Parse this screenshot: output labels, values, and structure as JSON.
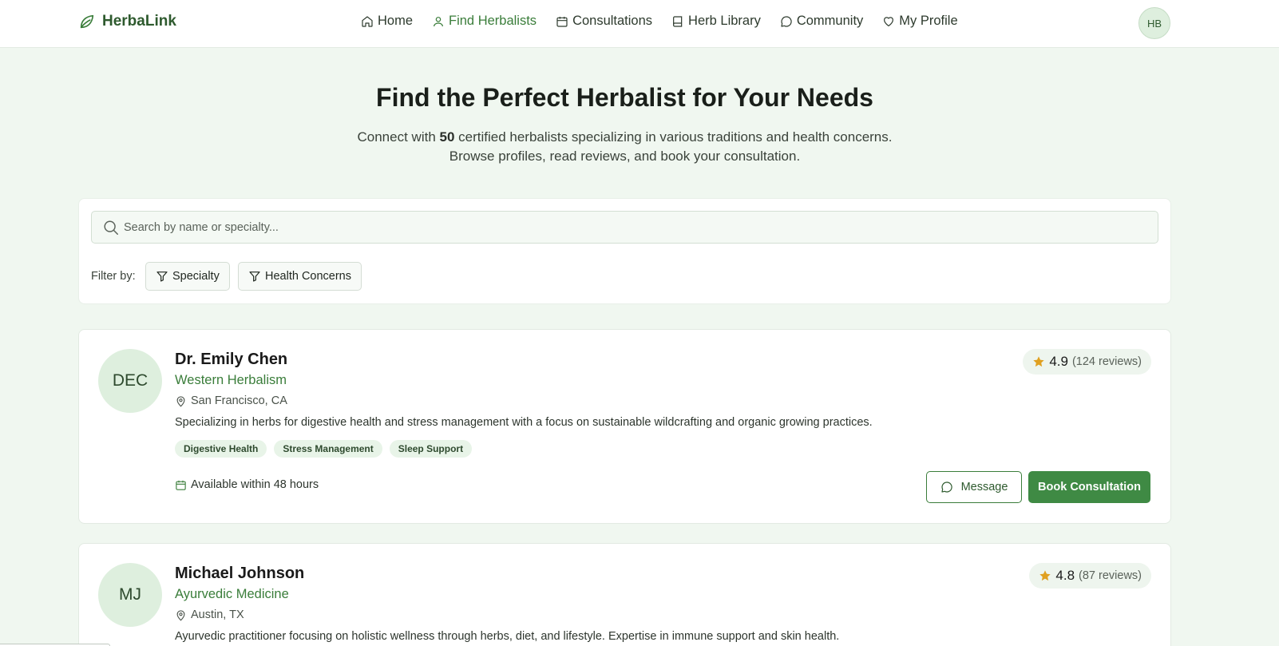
{
  "header": {
    "brand": "HerbaLink",
    "nav": [
      {
        "label": "Home",
        "icon": "home-icon",
        "active": false
      },
      {
        "label": "Find Herbalists",
        "icon": "user-icon",
        "active": true
      },
      {
        "label": "Consultations",
        "icon": "calendar-icon",
        "active": false
      },
      {
        "label": "Herb Library",
        "icon": "book-icon",
        "active": false
      },
      {
        "label": "Community",
        "icon": "chat-bubble-icon",
        "active": false
      },
      {
        "label": "My Profile",
        "icon": "heart-icon",
        "active": false
      }
    ],
    "avatar_initials": "HB"
  },
  "hero": {
    "title": "Find the Perfect Herbalist for Your Needs",
    "sub_pre": "Connect with ",
    "count": "50",
    "sub_post": " certified herbalists specializing in various traditions and health concerns. Browse profiles, read reviews, and book your consultation."
  },
  "search": {
    "placeholder": "Search by name or specialty...",
    "filter_label": "Filter by:",
    "filters": [
      "Specialty",
      "Health Concerns"
    ]
  },
  "herbalists": [
    {
      "initials": "DEC",
      "name": "Dr. Emily Chen",
      "specialty": "Western Herbalism",
      "location": "San Francisco, CA",
      "description": "Specializing in herbs for digestive health and stress management with a focus on sustainable wildcrafting and organic growing practices.",
      "tags": [
        "Digestive Health",
        "Stress Management",
        "Sleep Support"
      ],
      "availability": "Available within 48 hours",
      "rating": "4.9",
      "reviews": "(124 reviews)",
      "message_label": "Message",
      "book_label": "Book Consultation"
    },
    {
      "initials": "MJ",
      "name": "Michael Johnson",
      "specialty": "Ayurvedic Medicine",
      "location": "Austin, TX",
      "description": "Ayurvedic practitioner focusing on holistic wellness through herbs, diet, and lifestyle. Expertise in immune support and skin health.",
      "rating": "4.8",
      "reviews": "(87 reviews)"
    }
  ],
  "colors": {
    "accent": "#3a7d3a",
    "button_green": "#3f8a44",
    "page_bg": "#f0f7f0",
    "star": "#e0a020"
  }
}
